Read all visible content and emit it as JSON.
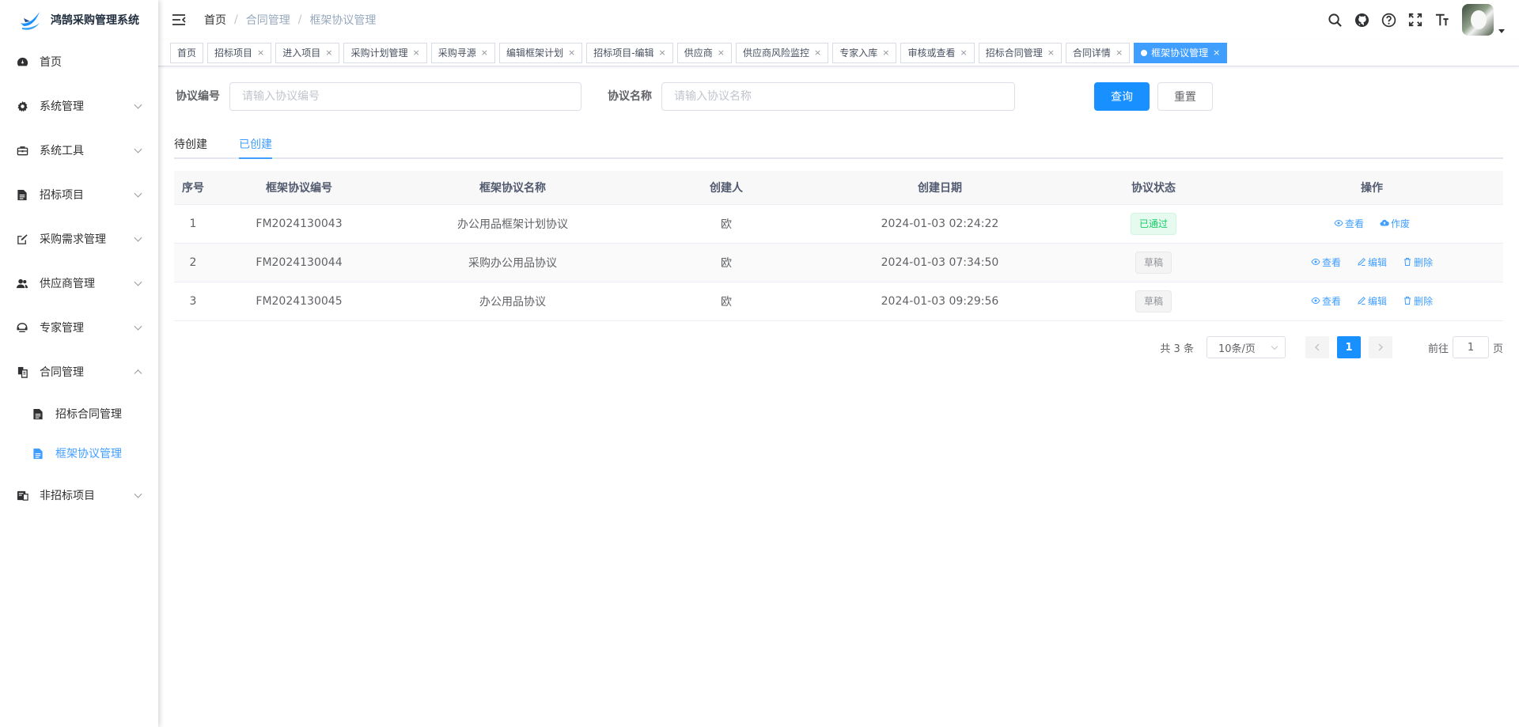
{
  "app": {
    "title": "鸿鹄采购管理系统"
  },
  "colors": {
    "primary": "#1890ff",
    "success": "#13ce66",
    "muted": "#909399"
  },
  "sidebar": {
    "items": [
      {
        "label": "首页",
        "icon": "dashboard-icon"
      },
      {
        "label": "系统管理",
        "icon": "gear-icon"
      },
      {
        "label": "系统工具",
        "icon": "toolbox-icon"
      },
      {
        "label": "招标项目",
        "icon": "document-icon"
      },
      {
        "label": "采购需求管理",
        "icon": "edit-icon"
      },
      {
        "label": "供应商管理",
        "icon": "users-icon"
      },
      {
        "label": "专家管理",
        "icon": "expert-icon"
      },
      {
        "label": "合同管理",
        "icon": "contract-icon"
      },
      {
        "label": "非招标项目",
        "icon": "folder-icon"
      }
    ],
    "sub_items": [
      {
        "label": "招标合同管理",
        "icon": "document-icon"
      },
      {
        "label": "框架协议管理",
        "icon": "document-icon"
      }
    ]
  },
  "breadcrumb": {
    "home": "首页",
    "parent": "合同管理",
    "current": "框架协议管理",
    "sep": "/"
  },
  "tags": [
    {
      "label": "首页"
    },
    {
      "label": "招标项目"
    },
    {
      "label": "进入项目"
    },
    {
      "label": "采购计划管理"
    },
    {
      "label": "采购寻源"
    },
    {
      "label": "编辑框架计划"
    },
    {
      "label": "招标项目-编辑"
    },
    {
      "label": "供应商"
    },
    {
      "label": "供应商风险监控"
    },
    {
      "label": "专家入库"
    },
    {
      "label": "审核或查看"
    },
    {
      "label": "招标合同管理"
    },
    {
      "label": "合同详情"
    },
    {
      "label": "框架协议管理"
    }
  ],
  "tag_close": "×",
  "search": {
    "code_label": "协议编号",
    "code_placeholder": "请输入协议编号",
    "name_label": "协议名称",
    "name_placeholder": "请输入协议名称",
    "query_label": "查询",
    "reset_label": "重置"
  },
  "tabs": [
    {
      "label": "待创建"
    },
    {
      "label": "已创建"
    }
  ],
  "table": {
    "headers": [
      "序号",
      "框架协议编号",
      "框架协议名称",
      "创建人",
      "创建日期",
      "协议状态",
      "操作"
    ],
    "rows": [
      {
        "index": "1",
        "code": "FM2024130043",
        "name": "办公用品框架计划协议",
        "creator": "欧",
        "date": "2024-01-03 02:24:22",
        "status": "已通过"
      },
      {
        "index": "2",
        "code": "FM2024130044",
        "name": "采购办公用品协议",
        "creator": "欧",
        "date": "2024-01-03 07:34:50",
        "status": "草稿"
      },
      {
        "index": "3",
        "code": "FM2024130045",
        "name": "办公用品协议",
        "creator": "欧",
        "date": "2024-01-03 09:29:56",
        "status": "草稿"
      }
    ],
    "ops": {
      "view": "查看",
      "void": "作废",
      "edit": "编辑",
      "delete": "删除"
    }
  },
  "pagination": {
    "total": "共 3 条",
    "page_size": "10条/页",
    "current": "1",
    "goto_prefix": "前往",
    "goto_value": "1",
    "goto_suffix": "页"
  }
}
